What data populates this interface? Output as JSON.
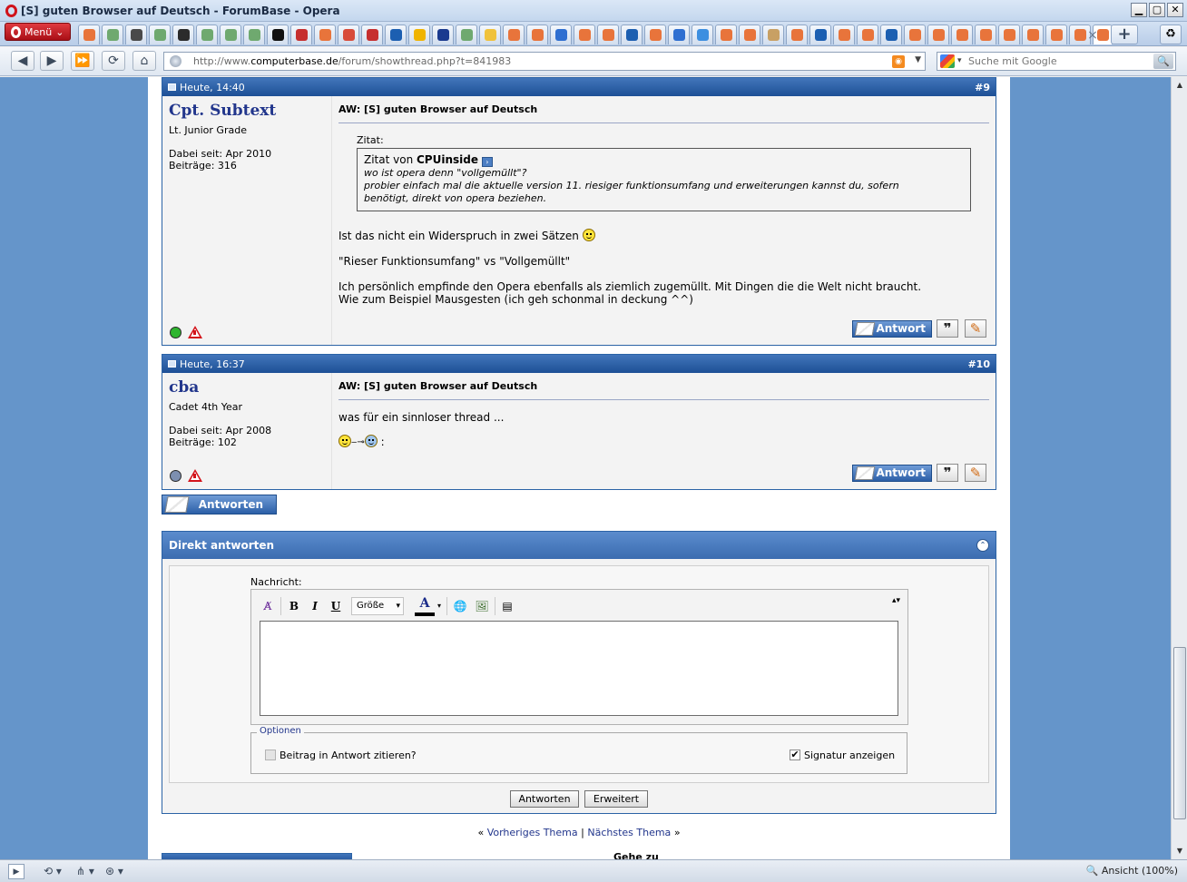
{
  "window": {
    "title": "[S] guten Browser auf Deutsch - ForumBase - Opera",
    "min": "▁",
    "max": "▢",
    "close": "✕"
  },
  "browser": {
    "menu_label": "Menü",
    "tab_close": "×",
    "tab_add": "+",
    "trash": "♻",
    "url_prefix": "http://www.",
    "url_host": "computerbase.de",
    "url_path": "/forum/showthread.php?t=841983",
    "search_placeholder": "Suche mit Google",
    "zoom_label": "Ansicht (100%)",
    "tab_colors": [
      "#e8743b",
      "#6fa96f",
      "#4a4a4a",
      "#6fa96f",
      "#2b2b2b",
      "#6fa96f",
      "#6fa96f",
      "#6fa96f",
      "#111111",
      "#c62f2f",
      "#e8743b",
      "#d84b3a",
      "#c62f2f",
      "#1c5fb1",
      "#f0b400",
      "#1a3a8f",
      "#6fa96f",
      "#f0c23b",
      "#e8743b",
      "#e8743b",
      "#2f6fd1",
      "#e8743b",
      "#e8743b",
      "#1c5fb1",
      "#e8743b",
      "#2f6fd1",
      "#3d8fe0",
      "#e8743b",
      "#e8743b",
      "#c8a064",
      "#e8743b",
      "#1c5fb1",
      "#e8743b",
      "#e8743b",
      "#1c5fb1",
      "#e8743b",
      "#e8743b",
      "#e8743b",
      "#e8743b",
      "#e8743b",
      "#e8743b",
      "#e8743b",
      "#e8743b",
      "#e8743b"
    ]
  },
  "posts": [
    {
      "date": "Heute, 14:40",
      "number": "#9",
      "username": "Cpt. Subtext",
      "rank": "Lt. Junior Grade",
      "joined": "Dabei seit: Apr 2010",
      "posts_count": "Beiträge: 316",
      "online_color": "#2fb52f",
      "title": "AW: [S] guten Browser auf Deutsch",
      "quote_label": "Zitat:",
      "quote_author_prefix": "Zitat von ",
      "quote_author": "CPUinside",
      "quote_lines": [
        "wo ist opera denn \"vollgemüllt\"?",
        "probier einfach mal die aktuelle version 11. riesiger funktionsumfang und erweiterungen kannst du, sofern",
        "benötigt, direkt von opera beziehen."
      ],
      "body_line1": "Ist das nicht ein Widerspruch in zwei Sätzen",
      "body_line2": "\"Rieser Funktionsumfang\" vs \"Vollgemüllt\"",
      "body_line3": "Ich persönlich empfinde den Opera ebenfalls als ziemlich zugemüllt. Mit Dingen die die Welt nicht braucht.",
      "body_line4": "Wie zum Beispiel Mausgesten (ich geh schonmal in deckung ^^)",
      "reply_label": "Antwort",
      "quote_btn": "❞",
      "edit_btn": "✎"
    },
    {
      "date": "Heute, 16:37",
      "number": "#10",
      "username": "cba",
      "rank": "Cadet 4th Year",
      "joined": "Dabei seit: Apr 2008",
      "posts_count": "Beiträge: 102",
      "online_color": "#7d8fb0",
      "title": "AW: [S] guten Browser auf Deutsch",
      "body_line1": "was für ein sinnloser thread ...",
      "body_line2": ":",
      "reply_label": "Antwort",
      "quote_btn": "❞",
      "edit_btn": "✎"
    }
  ],
  "reply_button": "Antworten",
  "quick_reply": {
    "title": "Direkt antworten",
    "collapse": "⌃",
    "message_label": "Nachricht:",
    "toolbar": {
      "bold": "B",
      "italic": "I",
      "underline": "U",
      "size": "Größe",
      "color_letter": "A",
      "resize": "▴▾"
    },
    "options_legend": "Optionen",
    "quote_option": "Beitrag in Antwort zitieren?",
    "signature_option": "Signatur anzeigen",
    "signature_checked": "✔",
    "submit": "Antworten",
    "advanced": "Erweitert"
  },
  "thread_nav": {
    "prev": "Vorheriges Thema",
    "sep": "|",
    "next": "Nächstes Thema",
    "laquo": "«",
    "raquo": "»"
  },
  "goto": "Gehe zu"
}
